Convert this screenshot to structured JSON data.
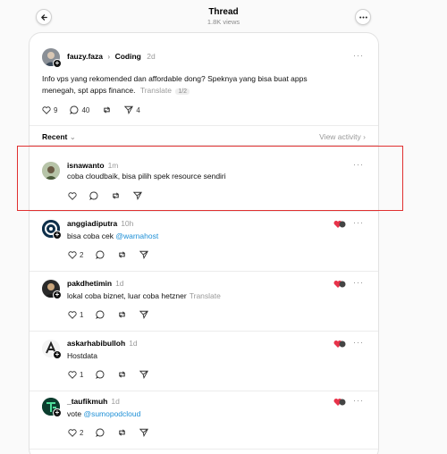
{
  "header": {
    "title": "Thread",
    "views": "1.8K views"
  },
  "main_post": {
    "username": "fauzy.faza",
    "topic": "Coding",
    "time": "2d",
    "text_line1": "Info vps yang rekomended dan affordable dong? Speknya yang bisa buat apps",
    "text_line2": "menegah, spt apps finance.",
    "translate": "Translate",
    "translate_pill": "1/2",
    "likes": "9",
    "comments": "40",
    "shares": "4"
  },
  "sort": {
    "label": "Recent",
    "view_activity": "View activity"
  },
  "replies": [
    {
      "username": "isnawanto",
      "time": "1m",
      "text": "coba cloudbaik, bisa pilih spek resource sendiri",
      "likes": "",
      "mention": ""
    },
    {
      "username": "anggiadiputra",
      "time": "10h",
      "text": "bisa coba cek ",
      "mention": "@warnahost",
      "likes": "2"
    },
    {
      "username": "pakdhetimin",
      "time": "1d",
      "text": "lokal coba biznet, luar coba hetzner",
      "translate": "Translate",
      "likes": "1"
    },
    {
      "username": "askarhabibulloh",
      "time": "1d",
      "text": "Hostdata",
      "likes": "1"
    },
    {
      "username": "_taufikmuh",
      "time": "1d",
      "text": "vote ",
      "mention": "@sumopodcloud",
      "likes": "2"
    }
  ],
  "colors": {
    "link": "#1d8fd6",
    "highlight_border": "#e03030",
    "muted": "#9a9a9a"
  }
}
